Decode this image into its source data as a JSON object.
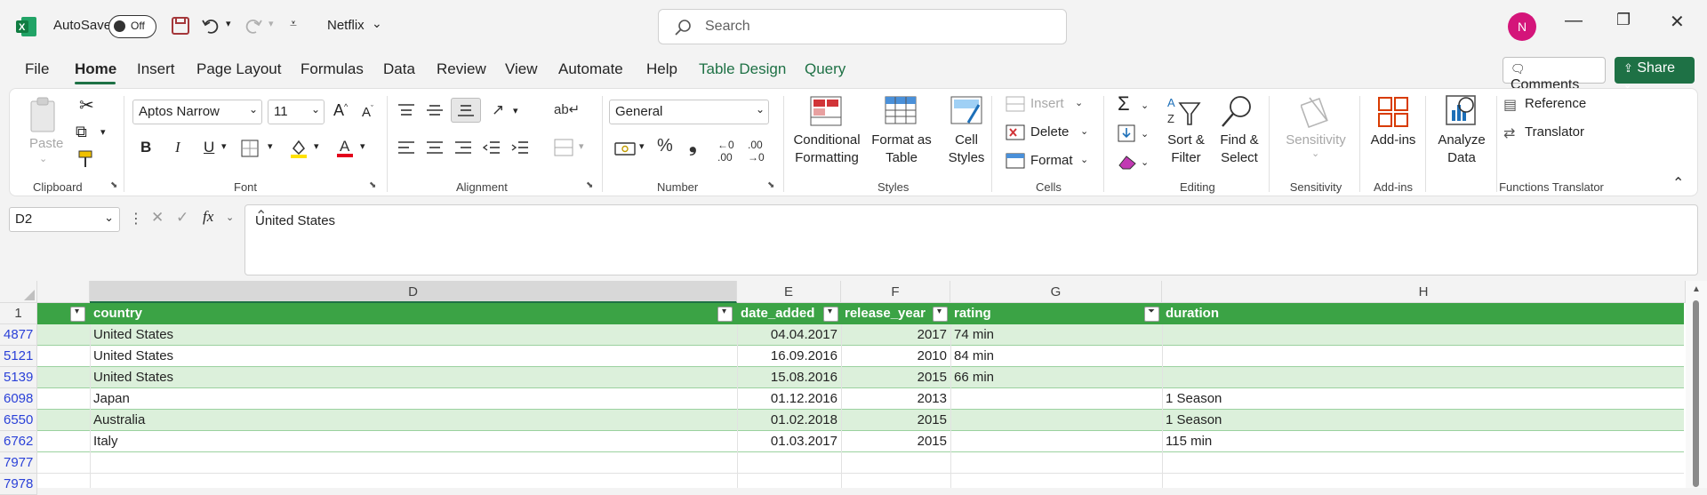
{
  "titlebar": {
    "autosave_label": "AutoSave",
    "autosave_state": "Off",
    "filename": "Netflix",
    "search_placeholder": "Search",
    "avatar_initial": "N"
  },
  "menu": {
    "items": [
      "File",
      "Home",
      "Insert",
      "Page Layout",
      "Formulas",
      "Data",
      "Review",
      "View",
      "Automate",
      "Help",
      "Table Design",
      "Query"
    ],
    "active": "Home",
    "comments": "Comments",
    "share": "Share"
  },
  "ribbon": {
    "clipboard": {
      "paste": "Paste",
      "label": "Clipboard"
    },
    "font": {
      "family": "Aptos Narrow",
      "size": "11",
      "label": "Font",
      "bold": "B",
      "italic": "I",
      "underline": "U"
    },
    "alignment": {
      "label": "Alignment"
    },
    "number": {
      "format": "General",
      "label": "Number"
    },
    "styles": {
      "cond1": "Conditional",
      "cond2": "Formatting",
      "fmt1": "Format as",
      "fmt2": "Table",
      "cell1": "Cell",
      "cell2": "Styles",
      "label": "Styles"
    },
    "cells": {
      "insert": "Insert",
      "delete": "Delete",
      "format": "Format",
      "label": "Cells"
    },
    "editing": {
      "sort1": "Sort &",
      "sort2": "Filter",
      "find1": "Find &",
      "find2": "Select",
      "label": "Editing"
    },
    "sensitivity": {
      "button": "Sensitivity",
      "label": "Sensitivity"
    },
    "addins": {
      "button": "Add-ins",
      "label": "Add-ins"
    },
    "analyze": {
      "l1": "Analyze",
      "l2": "Data"
    },
    "functions": {
      "reference": "Reference",
      "translator": "Translator",
      "label": "Functions Translator"
    }
  },
  "formula_bar": {
    "name_box": "D2",
    "fx": "fx",
    "value": "United States"
  },
  "sheet": {
    "col_headers": [
      "D",
      "E",
      "F",
      "G",
      "H"
    ],
    "header_row_num": "1",
    "table_headers": [
      "country",
      "date_added",
      "release_year",
      "rating",
      "duration"
    ],
    "rows": [
      {
        "num": "4877",
        "country": "United States",
        "date_added": "04.04.2017",
        "release_year": "2017",
        "rating": "74 min",
        "duration": ""
      },
      {
        "num": "5121",
        "country": "United States",
        "date_added": "16.09.2016",
        "release_year": "2010",
        "rating": "84 min",
        "duration": ""
      },
      {
        "num": "5139",
        "country": "United States",
        "date_added": "15.08.2016",
        "release_year": "2015",
        "rating": "66 min",
        "duration": ""
      },
      {
        "num": "6098",
        "country": "Japan",
        "date_added": "01.12.2016",
        "release_year": "2013",
        "rating": "",
        "duration": "1 Season"
      },
      {
        "num": "6550",
        "country": "Australia",
        "date_added": "01.02.2018",
        "release_year": "2015",
        "rating": "",
        "duration": "1 Season"
      },
      {
        "num": "6762",
        "country": "Italy",
        "date_added": "01.03.2017",
        "release_year": "2015",
        "rating": "",
        "duration": "115 min"
      }
    ],
    "empty_rows": [
      "7977",
      "7978"
    ]
  }
}
